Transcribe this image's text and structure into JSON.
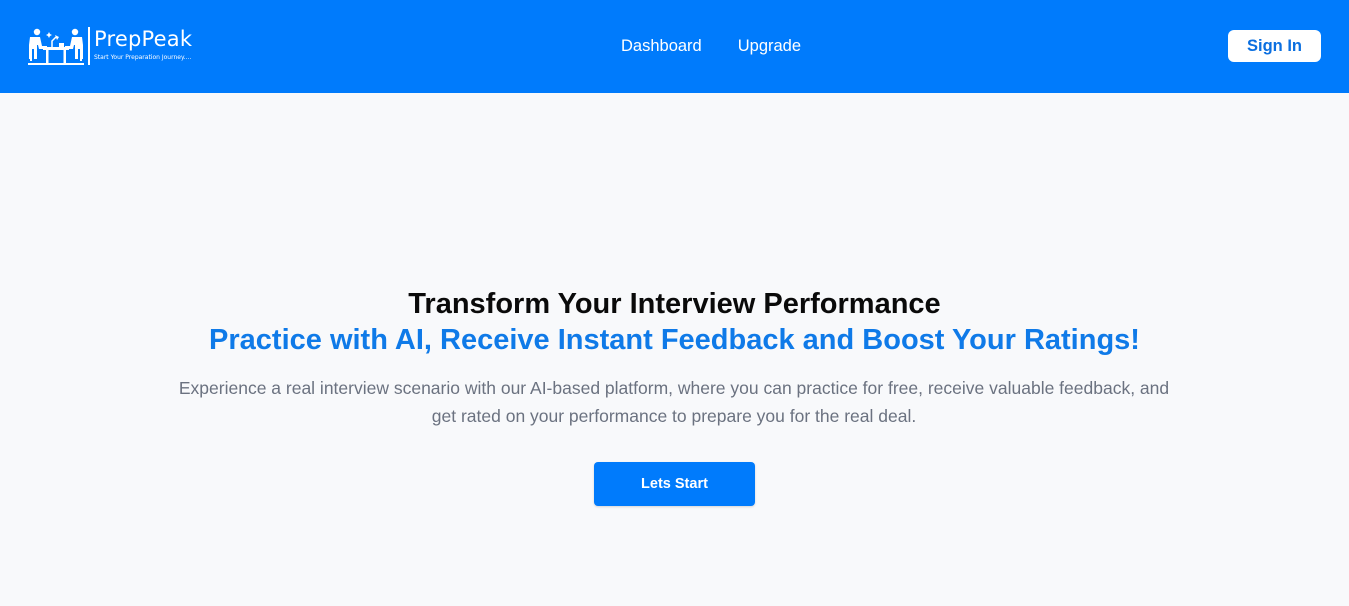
{
  "brand": {
    "name": "PrepPeak",
    "tagline": "Start Your Preparation Journey....",
    "logo_icon": "interview-desk-icon"
  },
  "nav": {
    "links": [
      {
        "label": "Dashboard"
      },
      {
        "label": "Upgrade"
      }
    ],
    "signin_label": "Sign In"
  },
  "hero": {
    "title": "Transform Your Interview Performance",
    "subtitle": "Practice with AI, Receive Instant Feedback and Boost Your Ratings!",
    "description": "Experience a real interview scenario with our AI-based platform, where you can practice for free, receive valuable feedback, and get rated on your performance to prepare you for the real deal.",
    "cta_label": "Lets Start"
  },
  "colors": {
    "primary": "#007bfc",
    "accent_text": "#0f7ae8",
    "background": "#f8f9fb",
    "muted_text": "#6b7280"
  }
}
